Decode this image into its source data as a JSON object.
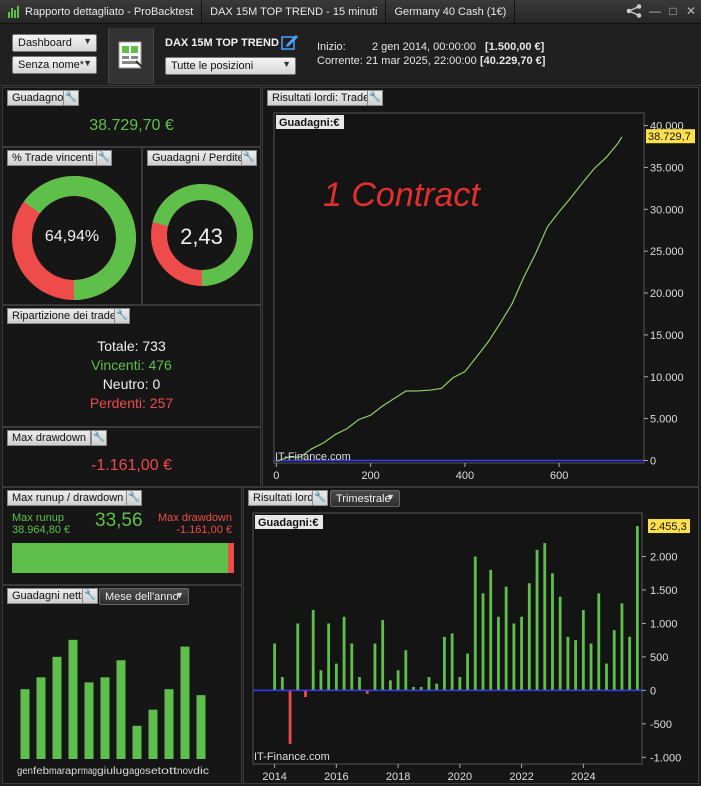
{
  "titlebar": {
    "app_title": "Rapporto dettagliato - ProBacktest",
    "tab_system": "DAX 15M TOP TREND - 15 minuti",
    "tab_instrument": "Germany 40 Cash (1€)"
  },
  "toolbar": {
    "view_select": "Dashboard",
    "name_select": "Senza nome*",
    "system_name": "DAX 15M TOP TREND",
    "positions_select": "Tutte le posizioni",
    "start_label": "Inizio:",
    "start_date": "2 gen 2014, 00:00:00",
    "start_value": "[1.500,00 €]",
    "current_label": "Corrente:",
    "current_date": "21 mar 2025, 22:00:00",
    "current_value": "[40.229,70 €]"
  },
  "gain_panel": {
    "title": "Guadagno",
    "value": "38.729,70 €"
  },
  "winrate_panel": {
    "title": "% Trade vincenti",
    "value": "64,94%",
    "fraction": 0.6494
  },
  "profitloss_panel": {
    "title": "Guadagni / Perdite",
    "value": "2,43",
    "fraction": 0.708
  },
  "breakdown_panel": {
    "title": "Ripartizione dei trade",
    "total_label": "Totale:",
    "total": "733",
    "win_label": "Vincenti:",
    "win": "476",
    "neutral_label": "Neutro:",
    "neutral": "0",
    "loss_label": "Perdenti:",
    "loss": "257"
  },
  "drawdown_panel": {
    "title": "Max drawdown",
    "value": "-1.161,00 €"
  },
  "runup_panel": {
    "title": "Max runup / drawdown",
    "runup_label": "Max runup",
    "runup_value": "38.964,80 €",
    "ratio": "33,56",
    "dd_label": "Max drawdown",
    "dd_value": "-1.161,00 €",
    "runup_fraction": 0.971
  },
  "monthly_panel": {
    "title": "Guadagni netti",
    "select": "Mese dell'anno"
  },
  "equity_panel": {
    "title": "Risultati lordi: Trade",
    "chart_label": "Guadagni:",
    "unit": "€",
    "watermark": "1 Contract",
    "source": "IT-Finance.com",
    "last_value": "38.729,7"
  },
  "quarterly_panel": {
    "title": "Risultati lordi",
    "select": "Trimestrale",
    "chart_label": "Guadagni:",
    "unit": "€",
    "source": "IT-Finance.com",
    "last_value": "2.455,3"
  },
  "colors": {
    "green": "#5ec04b",
    "red": "#ee4b4b",
    "equity_line": "#8fcf6a",
    "zero_line": "#3a3aff",
    "highlight": "#ffe14d"
  },
  "chart_data": [
    {
      "type": "line",
      "name": "equity",
      "x_ticks": [
        0,
        200,
        400,
        600
      ],
      "y_ticks": [
        0,
        5000,
        10000,
        15000,
        20000,
        25000,
        30000,
        35000,
        40000
      ],
      "y_tick_labels": [
        "0",
        "5.000",
        "10.000",
        "15.000",
        "20.000",
        "25.000",
        "30.000",
        "35.000",
        "40.000"
      ],
      "xlim": [
        -5,
        780
      ],
      "ylim": [
        -300,
        41500
      ],
      "x": [
        0,
        25,
        50,
        75,
        100,
        125,
        150,
        175,
        200,
        225,
        250,
        275,
        300,
        325,
        350,
        375,
        400,
        425,
        450,
        475,
        500,
        525,
        550,
        575,
        600,
        625,
        650,
        675,
        700,
        725,
        733
      ],
      "y": [
        0,
        300,
        500,
        1300,
        2200,
        3000,
        3900,
        4800,
        5500,
        6400,
        7500,
        8200,
        8400,
        8300,
        8700,
        9800,
        10700,
        12300,
        14300,
        16300,
        18800,
        21800,
        24800,
        27800,
        29800,
        31300,
        33300,
        34800,
        36300,
        37800,
        38729.7
      ]
    },
    {
      "type": "bar",
      "name": "quarterly",
      "x_ticks": [
        2014,
        2016,
        2018,
        2020,
        2022,
        2024
      ],
      "y_ticks": [
        -1000,
        -500,
        0,
        500,
        1000,
        1500,
        2000
      ],
      "y_tick_labels": [
        "-1.000",
        "-500",
        "0",
        "500",
        "1.000",
        "1.500",
        "2.000"
      ],
      "xlim": [
        2013.3,
        2025.9
      ],
      "ylim": [
        -1100,
        2650
      ],
      "start": 2014.0,
      "step": 0.25,
      "values": [
        700,
        200,
        -800,
        1000,
        -100,
        1200,
        300,
        1000,
        400,
        1100,
        700,
        200,
        -50,
        700,
        1050,
        150,
        300,
        600,
        50,
        50,
        200,
        100,
        800,
        850,
        200,
        550,
        2000,
        1450,
        1800,
        1100,
        1550,
        1000,
        1100,
        1600,
        2100,
        2200,
        1750,
        1400,
        800,
        750,
        1200,
        700,
        1450,
        400,
        900,
        1300,
        800,
        2455.3
      ]
    },
    {
      "type": "bar",
      "name": "monthly",
      "categories": [
        "gen",
        "feb",
        "mar",
        "apr",
        "mag",
        "giu",
        "lug",
        "ago",
        "set",
        "ott",
        "nov",
        "dic"
      ],
      "values": [
        4100,
        4800,
        6000,
        7000,
        4500,
        4800,
        5800,
        1950,
        2900,
        4100,
        6600,
        3750
      ],
      "ylim": [
        0,
        8400
      ]
    }
  ]
}
